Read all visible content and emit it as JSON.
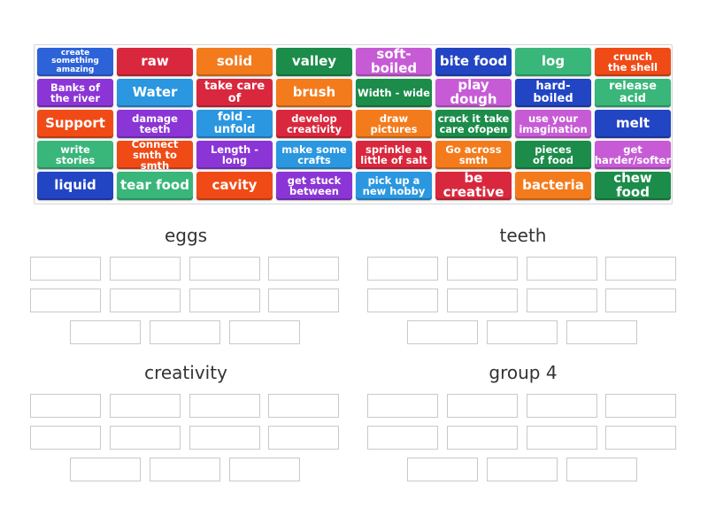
{
  "tiles": [
    {
      "label": "create something\namazing",
      "color": "#2d63d9",
      "cls": "c-blue",
      "size": "s-xxs"
    },
    {
      "label": "raw",
      "color": "#d9283d",
      "cls": "c-red",
      "size": "s-l"
    },
    {
      "label": "solid",
      "color": "#f47b1c",
      "cls": "c-orange",
      "size": "s-l"
    },
    {
      "label": "valley",
      "color": "#1b8c4a",
      "cls": "c-green",
      "size": "s-l"
    },
    {
      "label": "soft-boiled",
      "color": "#c75bd6",
      "cls": "c-pink",
      "size": "s-l"
    },
    {
      "label": "bite food",
      "color": "#2245c4",
      "cls": "c-navy",
      "size": "s-l"
    },
    {
      "label": "log",
      "color": "#39b67a",
      "cls": "c-teal",
      "size": "s-l"
    },
    {
      "label": "crunch\nthe shell",
      "color": "#f04b17",
      "cls": "c-orred",
      "size": "s-s"
    },
    {
      "label": "Banks of\nthe river",
      "color": "#8b35d6",
      "cls": "c-purple",
      "size": "s-s"
    },
    {
      "label": "Water",
      "color": "#2a97e0",
      "cls": "c-sky",
      "size": "s-l"
    },
    {
      "label": "take care of",
      "color": "#d9283d",
      "cls": "c-red",
      "size": "s-m"
    },
    {
      "label": "brush",
      "color": "#f47b1c",
      "cls": "c-orange",
      "size": "s-l"
    },
    {
      "label": "Width - wide",
      "color": "#1b8c4a",
      "cls": "c-green",
      "size": "s-s"
    },
    {
      "label": "play dough",
      "color": "#c75bd6",
      "cls": "c-pink",
      "size": "s-l"
    },
    {
      "label": "hard-boiled",
      "color": "#2245c4",
      "cls": "c-navy",
      "size": "s-m"
    },
    {
      "label": "release acid",
      "color": "#39b67a",
      "cls": "c-teal",
      "size": "s-m"
    },
    {
      "label": "Support",
      "color": "#f04b17",
      "cls": "c-orred",
      "size": "s-l"
    },
    {
      "label": "damage\nteeth",
      "color": "#8b35d6",
      "cls": "c-purple",
      "size": "s-s"
    },
    {
      "label": "fold - unfold",
      "color": "#2a97e0",
      "cls": "c-sky",
      "size": "s-m"
    },
    {
      "label": "develop\ncreativity",
      "color": "#d9283d",
      "cls": "c-red",
      "size": "s-s"
    },
    {
      "label": "draw\npictures",
      "color": "#f47b1c",
      "cls": "c-orange",
      "size": "s-s"
    },
    {
      "label": "crack it take\ncare ofopen",
      "color": "#1b8c4a",
      "cls": "c-green",
      "size": "s-s"
    },
    {
      "label": "use your\nimagination",
      "color": "#c75bd6",
      "cls": "c-pink",
      "size": "s-s"
    },
    {
      "label": "melt",
      "color": "#2245c4",
      "cls": "c-navy",
      "size": "s-l"
    },
    {
      "label": "write stories",
      "color": "#39b67a",
      "cls": "c-teal",
      "size": "s-s"
    },
    {
      "label": "Connect\nsmth to smth",
      "color": "#f04b17",
      "cls": "c-orred",
      "size": "s-s"
    },
    {
      "label": "Length - long",
      "color": "#8b35d6",
      "cls": "c-purple",
      "size": "s-s"
    },
    {
      "label": "make some\ncrafts",
      "color": "#2a97e0",
      "cls": "c-sky",
      "size": "s-s"
    },
    {
      "label": "sprinkle a\nlittle of salt",
      "color": "#d9283d",
      "cls": "c-red",
      "size": "s-s"
    },
    {
      "label": "Go across\nsmth",
      "color": "#f47b1c",
      "cls": "c-orange",
      "size": "s-s"
    },
    {
      "label": "pieces\nof food",
      "color": "#1b8c4a",
      "cls": "c-green",
      "size": "s-s"
    },
    {
      "label": "get\nharder/softer",
      "color": "#c75bd6",
      "cls": "c-pink",
      "size": "s-s"
    },
    {
      "label": "liquid",
      "color": "#2245c4",
      "cls": "c-navy",
      "size": "s-l"
    },
    {
      "label": "tear food",
      "color": "#39b67a",
      "cls": "c-teal",
      "size": "s-l"
    },
    {
      "label": "cavity",
      "color": "#f04b17",
      "cls": "c-orred",
      "size": "s-l"
    },
    {
      "label": "get stuck\nbetween",
      "color": "#8b35d6",
      "cls": "c-purple",
      "size": "s-s"
    },
    {
      "label": "pick up a\nnew hobby",
      "color": "#2a97e0",
      "cls": "c-sky",
      "size": "s-s"
    },
    {
      "label": "be creative",
      "color": "#d9283d",
      "cls": "c-red",
      "size": "s-l"
    },
    {
      "label": "bacteria",
      "color": "#f47b1c",
      "cls": "c-orange",
      "size": "s-l"
    },
    {
      "label": "chew food",
      "color": "#1b8c4a",
      "cls": "c-green",
      "size": "s-l"
    }
  ],
  "groups": [
    {
      "title": "eggs"
    },
    {
      "title": "teeth"
    },
    {
      "title": "creativity"
    },
    {
      "title": "group 4"
    }
  ]
}
